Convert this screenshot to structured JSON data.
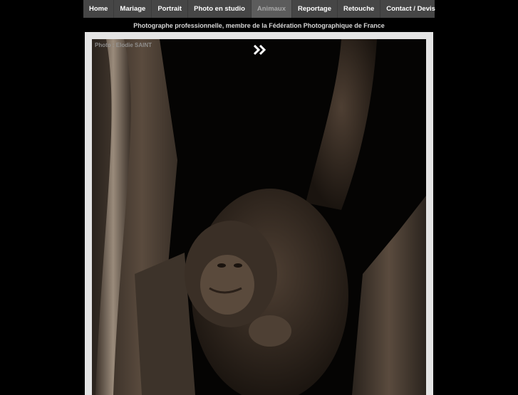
{
  "nav": {
    "items": [
      {
        "label": "Home"
      },
      {
        "label": "Mariage"
      },
      {
        "label": "Portrait"
      },
      {
        "label": "Photo en studio"
      },
      {
        "label": "Animaux",
        "active": true
      },
      {
        "label": "Reportage"
      },
      {
        "label": "Retouche"
      },
      {
        "label": "Contact / Devis"
      }
    ]
  },
  "tagline": "Photographe professionnelle, membre de la Fédération Photographique de France",
  "photo": {
    "credit": "Photo : Elodie SAINT",
    "next_icon": "double-chevron-right-icon"
  },
  "colors": {
    "nav_bg": "#464646",
    "nav_active_bg": "#5c5c5c",
    "frame_bg": "#e4e4e4",
    "page_bg": "#000000"
  }
}
